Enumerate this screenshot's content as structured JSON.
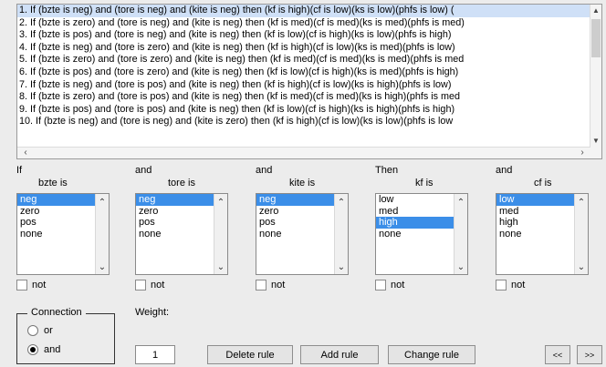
{
  "rules": [
    "1. If (bzte is neg) and (tore is neg) and (kite is neg) then (kf is high)(cf is low)(ks is low)(phfs is low) (",
    "2. If (bzte is zero) and (tore is neg) and (kite is neg) then (kf is med)(cf is med)(ks is med)(phfs is med)",
    "3. If (bzte is pos) and (tore is neg) and (kite is neg) then (kf is low)(cf is high)(ks is low)(phfs is high)",
    "4. If (bzte is neg) and (tore is zero) and (kite is neg) then (kf is high)(cf is low)(ks is med)(phfs is low)",
    "5. If (bzte is zero) and (tore is zero) and (kite is neg) then (kf is med)(cf is med)(ks is med)(phfs is med",
    "6. If (bzte is pos) and (tore is zero) and (kite is neg) then (kf is low)(cf is high)(ks is med)(phfs is high)",
    "7. If (bzte is neg) and (tore is pos) and (kite is neg) then (kf is high)(cf is low)(ks is high)(phfs is low)",
    "8. If (bzte is zero) and (tore is pos) and (kite is neg) then (kf is med)(cf is med)(ks is high)(phfs is med",
    "9. If (bzte is pos) and (tore is pos) and (kite is neg) then (kf is low)(cf is high)(ks is high)(phfs is high)",
    "10. If (bzte is neg) and (tore is neg) and (kite is zero) then (kf is high)(cf is low)(ks is low)(phfs is low"
  ],
  "columns": [
    {
      "prefix": "If",
      "var": "bzte is",
      "options": [
        "neg",
        "zero",
        "pos",
        "none"
      ],
      "selected": "neg",
      "not_label": "not"
    },
    {
      "prefix": "and",
      "var": "tore is",
      "options": [
        "neg",
        "zero",
        "pos",
        "none"
      ],
      "selected": "neg",
      "not_label": "not"
    },
    {
      "prefix": "and",
      "var": "kite is",
      "options": [
        "neg",
        "zero",
        "pos",
        "none"
      ],
      "selected": "neg",
      "not_label": "not"
    },
    {
      "prefix": "Then",
      "var": "kf is",
      "options": [
        "low",
        "med",
        "high",
        "none"
      ],
      "selected": "high",
      "not_label": "not"
    },
    {
      "prefix": "and",
      "var": "cf is",
      "options": [
        "low",
        "med",
        "high",
        "none"
      ],
      "selected": "low",
      "not_label": "not"
    }
  ],
  "connection": {
    "label": "Connection",
    "options": [
      "or",
      "and"
    ],
    "selected": "and"
  },
  "weight": {
    "label": "Weight:",
    "value": "1"
  },
  "buttons": {
    "delete": "Delete rule",
    "add": "Add rule",
    "change": "Change rule",
    "prev": "<<",
    "next": ">>"
  },
  "colors": {
    "selection": "#3b8ee8",
    "background": "#ececec"
  }
}
